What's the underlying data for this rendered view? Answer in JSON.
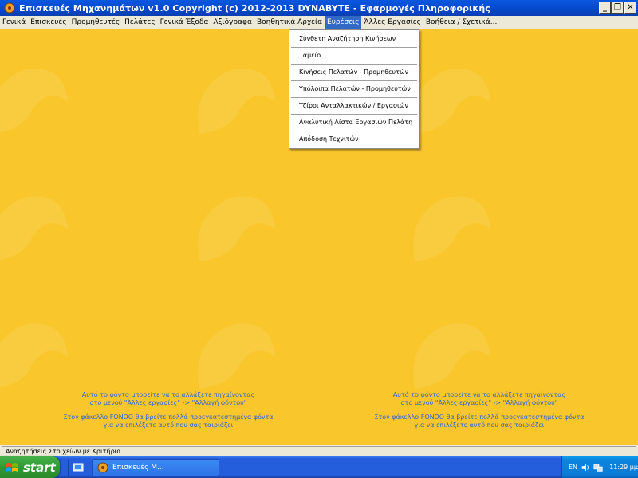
{
  "window": {
    "title": "Επισκευές Μηχανημάτων  v1.0    Copyright (c) 2012-2013  DYNABYTE - Εφαρμογές Πληροφορικής",
    "minimize_glyph": "_",
    "restore_glyph": "❐",
    "close_glyph": "✕"
  },
  "menubar": {
    "items": [
      {
        "label": "Γενικά"
      },
      {
        "label": "Επισκευές"
      },
      {
        "label": "Προμηθευτές"
      },
      {
        "label": "Πελάτες"
      },
      {
        "label": "Γενικά Έξοδα"
      },
      {
        "label": "Αξιόγραφα"
      },
      {
        "label": "Βοηθητικά Αρχεία"
      },
      {
        "label": "Ευρέσεις"
      },
      {
        "label": "Άλλες Εργασίες"
      },
      {
        "label": "Βοήθεια / Σχετικά..."
      }
    ],
    "active_index": 7
  },
  "dropdown": {
    "items": [
      {
        "label": "Σύνθετη Αναζήτηση Κινήσεων"
      },
      {
        "label": "Ταμείο"
      },
      {
        "label": "Κινήσεις Πελατών - Προμηθευτών"
      },
      {
        "label": "Υπόλοιπα Πελατών - Προμηθευτών"
      },
      {
        "label": "Τζίροι Ανταλλακτικών / Εργασιών"
      },
      {
        "label": "Αναλυτική Λίστα Εργασιών Πελάτη"
      },
      {
        "label": "Απόδοση Τεχνιτών"
      }
    ]
  },
  "background_hint": {
    "line1": "Αυτό το φόντο μπορείτε να το αλλάξετε πηγαίνοντας",
    "line2": "στο μενού \"Άλλες εργασίες\" -> \"Αλλαγή φόντου\"",
    "line3": "Στον φάκελλο FONDO θα βρείτε πολλά προεγκατεστημένα φόντα",
    "line4": "για να επιλέξετε αυτό που σας ταιριάζει"
  },
  "statusbar": {
    "text": "Αναζητήσεις Στοιχείων με Κριτήρια"
  },
  "taskbar": {
    "start_label": "start",
    "task_label": "Επισκευές Μ...",
    "language": "EN",
    "clock": "11:29 μμ"
  },
  "colors": {
    "background": "#f9c72c",
    "hint_text": "#2e62d8",
    "menu_highlight": "#316ac5",
    "titlebar": "#0547c9"
  }
}
